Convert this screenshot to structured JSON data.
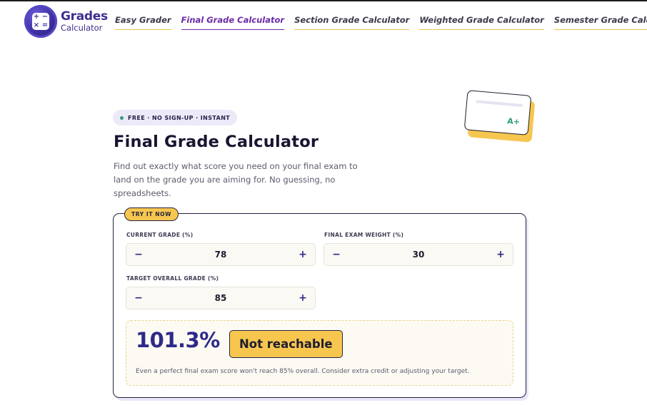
{
  "brand": {
    "line1": "Grades",
    "line2": "Calculator"
  },
  "nav": [
    {
      "label": "Easy Grader"
    },
    {
      "label": "Final Grade Calculator",
      "active": true
    },
    {
      "label": "Section Grade Calculator"
    },
    {
      "label": "Weighted Grade Calculator"
    },
    {
      "label": "Semester Grade Calculator"
    }
  ],
  "hero": {
    "badge": "FREE · NO SIGN-UP · INSTANT",
    "title": "Final Grade Calculator",
    "subtitle": "Find out exactly what score you need on your final exam to land on the grade you are aiming for. No guessing, no spreadsheets.",
    "illustration_grade": "A+"
  },
  "calculator": {
    "tag": "TRY IT NOW",
    "current_grade": {
      "label": "CURRENT GRADE (%)",
      "value": "78"
    },
    "final_weight": {
      "label": "FINAL EXAM WEIGHT (%)",
      "value": "30"
    },
    "target_grade": {
      "label": "TARGET OVERALL GRADE (%)",
      "value": "85"
    },
    "minus": "−",
    "plus": "+",
    "result": {
      "value": "101.3%",
      "status": "Not reachable",
      "note": "Even a perfect final exam score won't reach 85% overall. Consider extra credit or adjusting your target."
    }
  },
  "colors": {
    "accent": "#6b2ba8",
    "brand": "#3b2f8f",
    "highlight": "#f6c64f",
    "success": "#2c9d76"
  }
}
